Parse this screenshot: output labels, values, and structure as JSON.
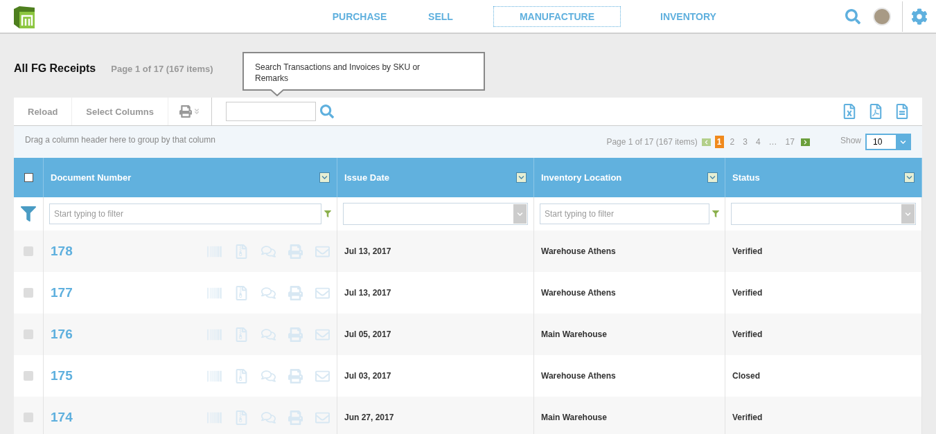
{
  "nav": {
    "tabs": [
      {
        "label": "PURCHASE",
        "selected": false
      },
      {
        "label": "SELL",
        "selected": false
      },
      {
        "label": "MANUFACTURE",
        "selected": true
      },
      {
        "label": "INVENTORY",
        "selected": false
      }
    ]
  },
  "page": {
    "title": "All FG Receipts",
    "summary": "Page 1 of 17 (167 items)"
  },
  "tooltip": "Search Transactions and Invoices by SKU or Remarks",
  "toolbar": {
    "buttons": [
      "Reload",
      "Select Columns"
    ]
  },
  "group_hint": "Drag a column header here to group by that column",
  "pager": {
    "summary": "Page 1 of 17 (167 items)",
    "pages": [
      {
        "label": "1",
        "selected": true
      },
      {
        "label": "2",
        "selected": false
      },
      {
        "label": "3",
        "selected": false
      },
      {
        "label": "4",
        "selected": false
      },
      {
        "label": "…",
        "selected": false
      },
      {
        "label": "17",
        "selected": false
      }
    ],
    "show_label": "Show",
    "show_value": "10"
  },
  "table": {
    "select_all": {
      "checked": false
    },
    "columns": [
      {
        "label": "Document Number"
      },
      {
        "label": "Issue Date"
      },
      {
        "label": "Inventory Location"
      },
      {
        "label": "Status"
      }
    ],
    "filters": [
      {
        "kind": "text",
        "placeholder": "Start typing to filter"
      },
      {
        "kind": "select"
      },
      {
        "kind": "text",
        "placeholder": "Start typing to filter"
      },
      {
        "kind": "select"
      }
    ],
    "rows": [
      {
        "checked": false,
        "number": "178",
        "date": "Jul 13, 2017",
        "location": "Warehouse Athens",
        "status": "Verified"
      },
      {
        "checked": false,
        "number": "177",
        "date": "Jul 13, 2017",
        "location": "Warehouse Athens",
        "status": "Verified"
      },
      {
        "checked": false,
        "number": "176",
        "date": "Jul 05, 2017",
        "location": "Main Warehouse",
        "status": "Verified"
      },
      {
        "checked": false,
        "number": "175",
        "date": "Jul 03, 2017",
        "location": "Warehouse Athens",
        "status": "Closed"
      },
      {
        "checked": false,
        "number": "174",
        "date": "Jun 27, 2017",
        "location": "Main Warehouse",
        "status": "Verified"
      }
    ]
  }
}
